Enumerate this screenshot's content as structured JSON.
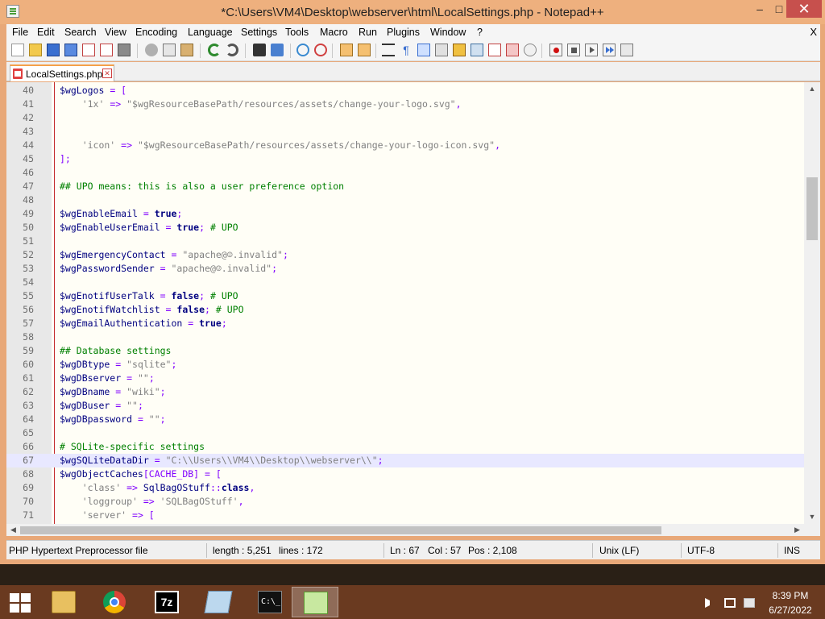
{
  "window": {
    "title": "*C:\\Users\\VM4\\Desktop\\webserver\\html\\LocalSettings.php - Notepad++",
    "min_glyph": "–",
    "max_glyph": "□",
    "close_glyph": "✕"
  },
  "menu": {
    "items": [
      "File",
      "Edit",
      "Search",
      "View",
      "Encoding",
      "Language",
      "Settings",
      "Tools",
      "Macro",
      "Run",
      "Plugins",
      "Window",
      "?"
    ],
    "doc_close": "X"
  },
  "toolbar": {
    "icons": [
      "new-file-icon",
      "open-file-icon",
      "save-icon",
      "save-all-icon",
      "close-icon",
      "close-all-icon",
      "print-icon",
      "cut-icon",
      "copy-icon",
      "paste-icon",
      "undo-icon",
      "redo-icon",
      "find-icon",
      "replace-icon",
      "zoom-in-icon",
      "zoom-out-icon",
      "sync-vertical-icon",
      "sync-horizontal-icon",
      "word-wrap-icon",
      "show-all-chars-icon",
      "indent-guide-icon",
      "user-lang-icon",
      "doc-map-icon",
      "function-list-icon",
      "folder-workspace-icon",
      "monitor-icon",
      "record-macro-icon",
      "stop-record-icon",
      "play-macro-icon",
      "play-multiple-icon",
      "save-macro-icon"
    ]
  },
  "tabs": [
    {
      "label": "LocalSettings.php",
      "close_glyph": "✕"
    }
  ],
  "editor": {
    "current_line": 67,
    "lines": [
      {
        "n": "40",
        "code": [
          [
            "var",
            "$wgLogos"
          ],
          [
            "op",
            " = ["
          ]
        ]
      },
      {
        "n": "41",
        "code": [
          [
            "str",
            "    '1x'"
          ],
          [
            "op",
            " => "
          ],
          [
            "str",
            "\"$wgResourceBasePath/resources/assets/change-your-logo.svg\""
          ],
          [
            "op",
            ","
          ]
        ]
      },
      {
        "n": "42",
        "code": []
      },
      {
        "n": "43",
        "code": []
      },
      {
        "n": "44",
        "code": [
          [
            "str",
            "    'icon'"
          ],
          [
            "op",
            " => "
          ],
          [
            "str",
            "\"$wgResourceBasePath/resources/assets/change-your-logo-icon.svg\""
          ],
          [
            "op",
            ","
          ]
        ]
      },
      {
        "n": "45",
        "code": [
          [
            "op",
            "];"
          ]
        ]
      },
      {
        "n": "46",
        "code": []
      },
      {
        "n": "47",
        "code": [
          [
            "cmt",
            "## UPO means: this is also a user preference option"
          ]
        ]
      },
      {
        "n": "48",
        "code": []
      },
      {
        "n": "49",
        "code": [
          [
            "var",
            "$wgEnableEmail"
          ],
          [
            "op",
            " = "
          ],
          [
            "kw",
            "true"
          ],
          [
            "op",
            ";"
          ]
        ]
      },
      {
        "n": "50",
        "code": [
          [
            "var",
            "$wgEnableUserEmail"
          ],
          [
            "op",
            " = "
          ],
          [
            "kw",
            "true"
          ],
          [
            "op",
            "; "
          ],
          [
            "cmt",
            "# UPO"
          ]
        ]
      },
      {
        "n": "51",
        "code": []
      },
      {
        "n": "52",
        "code": [
          [
            "var",
            "$wgEmergencyContact"
          ],
          [
            "op",
            " = "
          ],
          [
            "str",
            "\"apache@☺.invalid\""
          ],
          [
            "op",
            ";"
          ]
        ]
      },
      {
        "n": "53",
        "code": [
          [
            "var",
            "$wgPasswordSender"
          ],
          [
            "op",
            " = "
          ],
          [
            "str",
            "\"apache@☺.invalid\""
          ],
          [
            "op",
            ";"
          ]
        ]
      },
      {
        "n": "54",
        "code": []
      },
      {
        "n": "55",
        "code": [
          [
            "var",
            "$wgEnotifUserTalk"
          ],
          [
            "op",
            " = "
          ],
          [
            "kw",
            "false"
          ],
          [
            "op",
            "; "
          ],
          [
            "cmt",
            "# UPO"
          ]
        ]
      },
      {
        "n": "56",
        "code": [
          [
            "var",
            "$wgEnotifWatchlist"
          ],
          [
            "op",
            " = "
          ],
          [
            "kw",
            "false"
          ],
          [
            "op",
            "; "
          ],
          [
            "cmt",
            "# UPO"
          ]
        ]
      },
      {
        "n": "57",
        "code": [
          [
            "var",
            "$wgEmailAuthentication"
          ],
          [
            "op",
            " = "
          ],
          [
            "kw",
            "true"
          ],
          [
            "op",
            ";"
          ]
        ]
      },
      {
        "n": "58",
        "code": []
      },
      {
        "n": "59",
        "code": [
          [
            "cmt",
            "## Database settings"
          ]
        ]
      },
      {
        "n": "60",
        "code": [
          [
            "var",
            "$wgDBtype"
          ],
          [
            "op",
            " = "
          ],
          [
            "str",
            "\"sqlite\""
          ],
          [
            "op",
            ";"
          ]
        ]
      },
      {
        "n": "61",
        "code": [
          [
            "var",
            "$wgDBserver"
          ],
          [
            "op",
            " = "
          ],
          [
            "str",
            "\"\""
          ],
          [
            "op",
            ";"
          ]
        ]
      },
      {
        "n": "62",
        "code": [
          [
            "var",
            "$wgDBname"
          ],
          [
            "op",
            " = "
          ],
          [
            "str",
            "\"wiki\""
          ],
          [
            "op",
            ";"
          ]
        ]
      },
      {
        "n": "63",
        "code": [
          [
            "var",
            "$wgDBuser"
          ],
          [
            "op",
            " = "
          ],
          [
            "str",
            "\"\""
          ],
          [
            "op",
            ";"
          ]
        ]
      },
      {
        "n": "64",
        "code": [
          [
            "var",
            "$wgDBpassword"
          ],
          [
            "op",
            " = "
          ],
          [
            "str",
            "\"\""
          ],
          [
            "op",
            ";"
          ]
        ]
      },
      {
        "n": "65",
        "code": []
      },
      {
        "n": "66",
        "code": [
          [
            "cmt",
            "# SQLite-specific settings"
          ]
        ]
      },
      {
        "n": "67",
        "code": [
          [
            "var",
            "$wgSQLiteDataDir"
          ],
          [
            "op",
            " = "
          ],
          [
            "str",
            "\"C:\\\\Users\\\\VM4\\\\Desktop\\\\webserver\\\\\""
          ],
          [
            "op",
            ";"
          ]
        ]
      },
      {
        "n": "68",
        "code": [
          [
            "var",
            "$wgObjectCaches"
          ],
          [
            "op",
            "[CACHE_DB] = ["
          ]
        ]
      },
      {
        "n": "69",
        "code": [
          [
            "str",
            "    'class'"
          ],
          [
            "op",
            " => "
          ],
          [
            "var",
            "SqlBagOStuff"
          ],
          [
            "op",
            "::"
          ],
          [
            "kw",
            "class"
          ],
          [
            "op",
            ","
          ]
        ]
      },
      {
        "n": "70",
        "code": [
          [
            "str",
            "    'loggroup'"
          ],
          [
            "op",
            " => "
          ],
          [
            "str",
            "'SQLBagOStuff'"
          ],
          [
            "op",
            ","
          ]
        ]
      },
      {
        "n": "71",
        "code": [
          [
            "str",
            "    'server'"
          ],
          [
            "op",
            " => ["
          ]
        ]
      }
    ]
  },
  "statusbar": {
    "filetype": "PHP Hypertext Preprocessor file",
    "length": "length : 5,251",
    "lines": "lines : 172",
    "ln": "Ln : 67",
    "col": "Col : 57",
    "pos": "Pos : 2,108",
    "eol": "Unix (LF)",
    "encoding": "UTF-8",
    "mode": "INS"
  },
  "taskbar": {
    "apps": [
      "file-explorer-icon",
      "chrome-icon",
      "7zip-icon",
      "notepad-icon",
      "cmd-icon",
      "notepadpp-icon"
    ],
    "time": "8:39 PM",
    "date": "6/27/2022"
  },
  "colors": {
    "title_bg": "#eeb07e",
    "var": "#000080",
    "string": "#808080",
    "comment": "#008000",
    "operator": "#8000ff",
    "current_line": "#e8e8ff"
  }
}
